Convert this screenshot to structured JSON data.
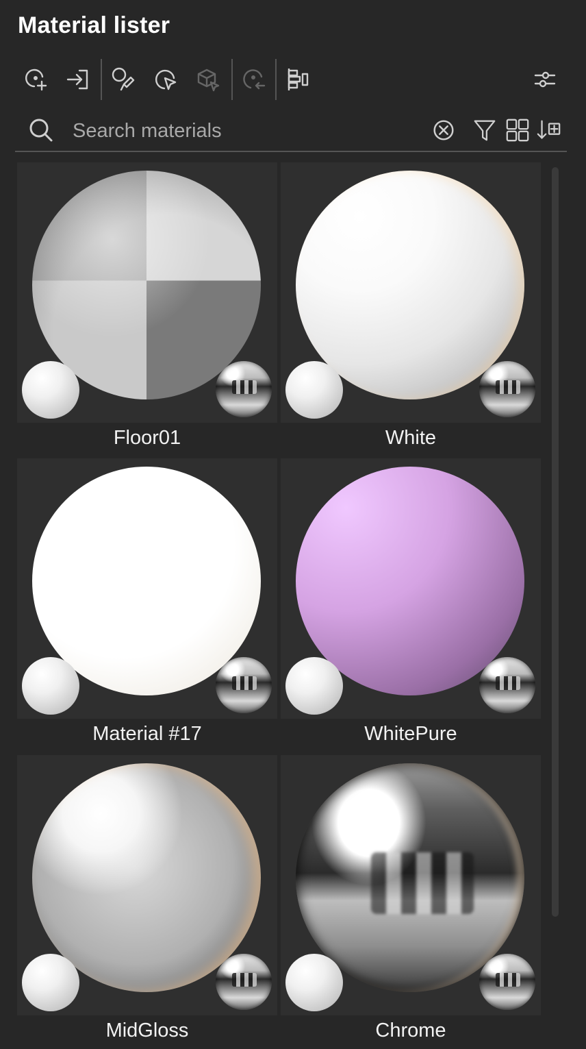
{
  "title": "Material lister",
  "toolbar": {
    "buttons": [
      {
        "name": "create-material-icon",
        "state": "enabled"
      },
      {
        "name": "import-material-icon",
        "state": "enabled"
      },
      {
        "name": "pick-material-eyedropper-icon",
        "state": "enabled"
      },
      {
        "name": "select-objects-icon",
        "state": "enabled"
      },
      {
        "name": "select-by-material-icon",
        "state": "disabled"
      },
      {
        "name": "replace-material-icon",
        "state": "disabled"
      },
      {
        "name": "material-tree-icon",
        "state": "enabled"
      }
    ],
    "settings_icon": "settings-sliders-icon"
  },
  "search": {
    "placeholder": "Search materials",
    "value": "",
    "icons": [
      "clear-icon",
      "filter-icon",
      "grid-view-icon",
      "sort-icon"
    ]
  },
  "materials": [
    {
      "name": "Floor01",
      "preview": "checker"
    },
    {
      "name": "White",
      "preview": "white"
    },
    {
      "name": "Material #17",
      "preview": "pure-white"
    },
    {
      "name": "WhitePure",
      "preview": "pink"
    },
    {
      "name": "MidGloss",
      "preview": "midgloss"
    },
    {
      "name": "Chrome",
      "preview": "chrome"
    }
  ],
  "colors": {
    "background": "#272727",
    "tile": "#2f2f2f",
    "icon": "#cfcfcf",
    "icon_disabled": "#666666"
  }
}
